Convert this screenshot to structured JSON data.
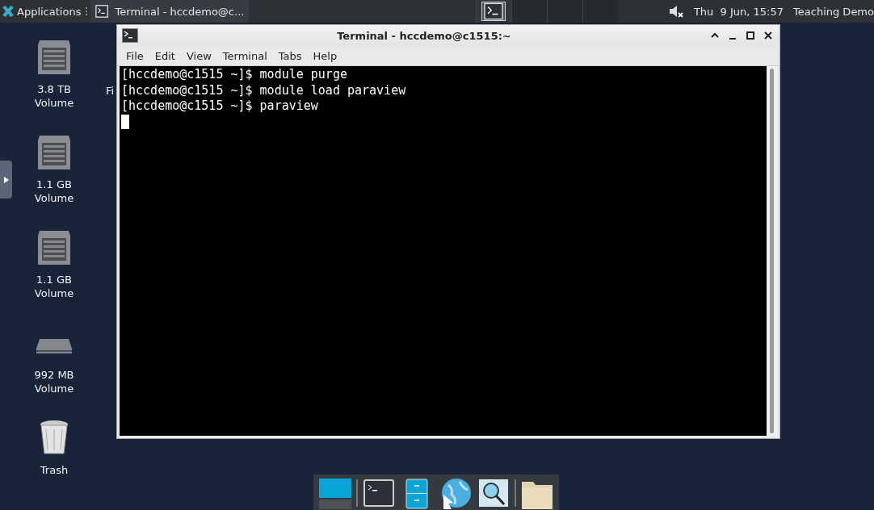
{
  "top_panel": {
    "applications_menu": "Applications",
    "tasks": [
      {
        "label": "Terminal - hccdemo@c...",
        "selected": false
      }
    ],
    "workspaces": [
      {
        "selected": true
      },
      {
        "selected": false
      },
      {
        "selected": false
      },
      {
        "selected": false
      }
    ],
    "muted": true,
    "clock": "Thu  9 Jun, 15:57",
    "user": "Teaching Demo"
  },
  "desktop_icons": [
    {
      "label": "3.8 TB Volume",
      "kind": "drive"
    },
    {
      "label": "1.1 GB Volume",
      "kind": "drive"
    },
    {
      "label": "1.1 GB Volume",
      "kind": "drive"
    },
    {
      "label": "992 MB Volume",
      "kind": "flat-drive"
    },
    {
      "label": "Trash",
      "kind": "trash"
    }
  ],
  "hidden_icon_label": "Fi",
  "window": {
    "title": "Terminal - hccdemo@c1515:~",
    "menu": [
      "File",
      "Edit",
      "View",
      "Terminal",
      "Tabs",
      "Help"
    ],
    "lines": [
      "[hccdemo@c1515 ~]$ module purge",
      "[hccdemo@c1515 ~]$ module load paraview",
      "[hccdemo@c1515 ~]$ paraview"
    ]
  }
}
